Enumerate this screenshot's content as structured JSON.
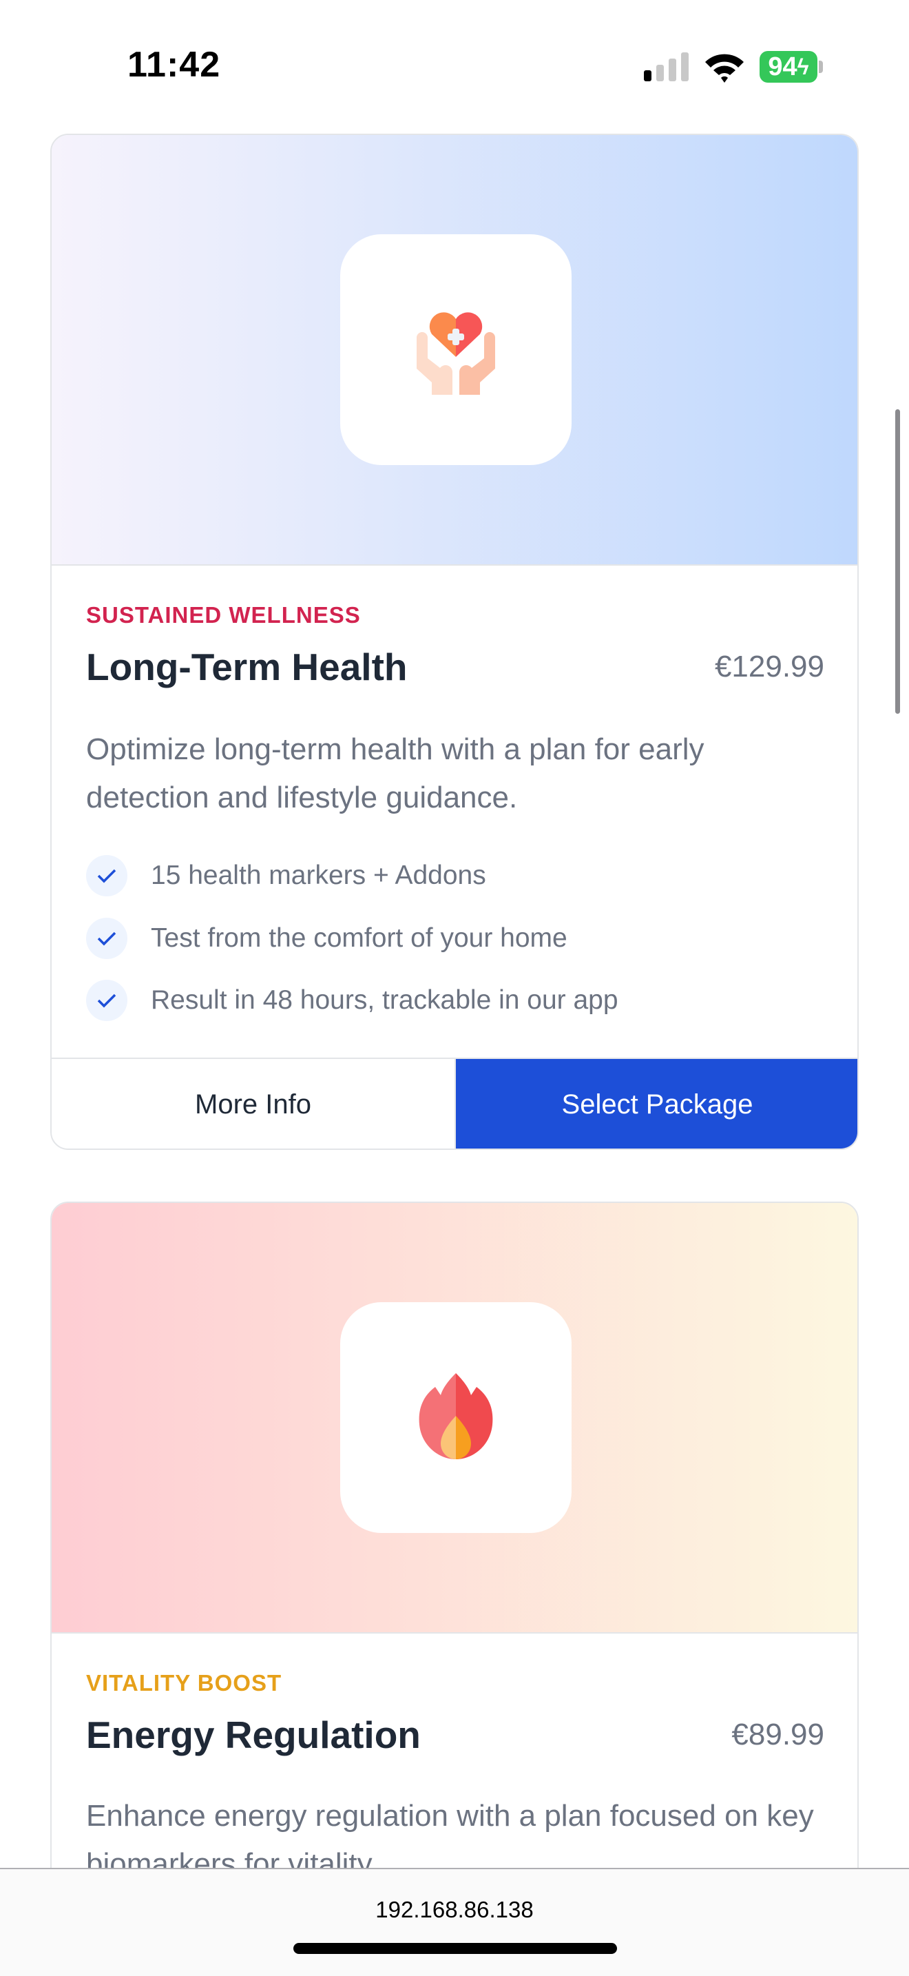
{
  "status_bar": {
    "time": "11:42",
    "battery": "94"
  },
  "cards": [
    {
      "category": "SUSTAINED WELLNESS",
      "category_color": "#d2234f",
      "title": "Long-Term Health",
      "price": "€129.99",
      "description": "Optimize long-term health with a plan for early detection and lifestyle guidance.",
      "features": [
        "15 health markers + Addons",
        "Test from the comfort of your home",
        "Result in 48 hours, trackable in our app"
      ],
      "icon": "heart-hands-icon",
      "more_info_label": "More Info",
      "select_label": "Select Package"
    },
    {
      "category": "VITALITY BOOST",
      "category_color": "#e6a01a",
      "title": "Energy Regulation",
      "price": "€89.99",
      "description": "Enhance energy regulation with a plan focused on key biomarkers for vitality.",
      "icon": "flame-icon"
    }
  ],
  "browser": {
    "url": "192.168.86.138"
  },
  "accent_color": "#1d4fd8"
}
